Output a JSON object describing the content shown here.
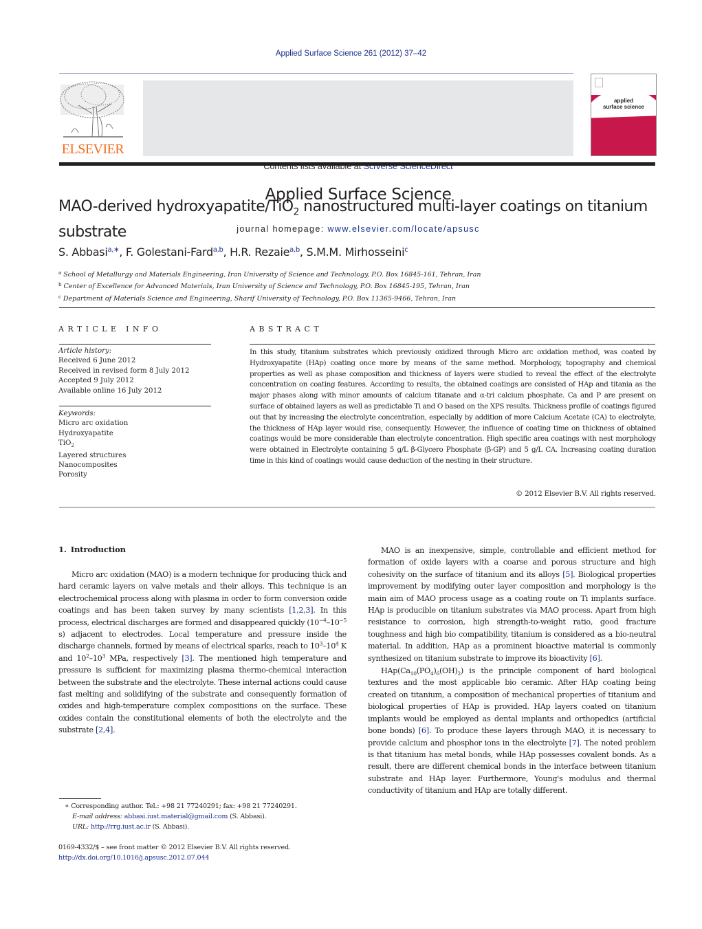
{
  "journal_ref": "Applied Surface Science 261 (2012) 37–42",
  "masthead": {
    "contents_prefix": "Contents lists available at ",
    "contents_link": "SciVerse ScienceDirect",
    "journal_title": "Applied Surface Science",
    "homepage_prefix": "journal homepage: ",
    "homepage_link": "www.elsevier.com/locate/apsusc",
    "publisher_logo_text": "ELSEVIER",
    "cover_title_line1": "applied",
    "cover_title_line2": "surface science"
  },
  "colors": {
    "link": "#1a2d8c",
    "elsevier_orange": "#f26b1d",
    "cover_magenta": "#c8174b",
    "masthead_gray": "#e6e7e8"
  },
  "article": {
    "title_part1": "MAO-derived hydroxyapatite/TiO",
    "title_sub": "2",
    "title_part2": " nanostructured multi-layer coatings on titanium substrate",
    "authors": [
      {
        "name": "S. Abbasi",
        "marks": "a,∗",
        "sep": ", "
      },
      {
        "name": "F. Golestani-Fard",
        "marks": "a,b",
        "sep": ", "
      },
      {
        "name": "H.R. Rezaie",
        "marks": "a,b",
        "sep": ", "
      },
      {
        "name": "S.M.M. Mirhosseini",
        "marks": "c",
        "sep": ""
      }
    ],
    "affiliations": [
      {
        "mark": "a",
        "text": "School of Metallurgy and Materials Engineering, Iran University of Science and Technology, P.O. Box 16845-161, Tehran, Iran"
      },
      {
        "mark": "b",
        "text": "Center of Excellence for Advanced Materials, Iran University of Science and Technology, P.O. Box 16845-195, Tehran, Iran"
      },
      {
        "mark": "c",
        "text": "Department of Materials Science and Engineering, Sharif University of Technology, P.O. Box 11365-9466, Tehran, Iran"
      }
    ]
  },
  "article_info": {
    "heading": "ARTICLE INFO",
    "history_label": "Article history:",
    "history": [
      "Received 6 June 2012",
      "Received in revised form 8 July 2012",
      "Accepted 9 July 2012",
      "Available online 16 July 2012"
    ],
    "keywords_label": "Keywords:",
    "keywords": [
      "Micro arc oxidation",
      "Hydroxyapatite",
      "TiO2",
      "Layered structures",
      "Nanocomposites",
      "Porosity"
    ]
  },
  "abstract": {
    "heading": "ABSTRACT",
    "text": "In this study, titanium substrates which previously oxidized through Micro arc oxidation method, was coated by Hydroxyapatite (HAp) coating once more by means of the same method. Morphology, topography and chemical properties as well as phase composition and thickness of layers were studied to reveal the effect of the electrolyte concentration on coating features. According to results, the obtained coatings are consisted of HAp and titania as the major phases along with minor amounts of calcium titanate and α-tri calcium phosphate. Ca and P are present on surface of obtained layers as well as predictable Ti and O based on the XPS results. Thickness profile of coatings figured out that by increasing the electrolyte concentration, especially by addition of more Calcium Acetate (CA) to electrolyte, the thickness of HAp layer would rise, consequently. However, the influence of coating time on thickness of obtained coatings would be more considerable than electrolyte concentration. High specific area coatings with nest morphology were obtained in Electrolyte containing 5 g/L β-Glycero Phosphate (β-GP) and 5 g/L CA. Increasing coating duration time in this kind of coatings would cause deduction of the nesting in their structure.",
    "copyright": "© 2012 Elsevier B.V. All rights reserved."
  },
  "body": {
    "section_number": "1.",
    "section_title": "Introduction",
    "intro_p1": {
      "t1": "Micro arc oxidation (MAO) is a modern technique for producing thick and hard ceramic layers on valve metals and their alloys. This technique is an electrochemical process along with plasma in order to form conversion oxide coatings and has been taken survey by many scientists ",
      "ref1": "[1,2,3]",
      "t2": ". In this process, electrical discharges are formed and disappeared quickly (10",
      "e1": "−4",
      "t3": "–10",
      "e2": "−5",
      "t4": " s) adjacent to electrodes. Local temperature and pressure inside the discharge channels, formed by means of electrical sparks, reach to 10",
      "e3": "3",
      "t5": "–10",
      "e4": "4",
      "t6": " K and 10",
      "e5": "2",
      "t7": "–10",
      "e6": "3",
      "t8": " MPa, respectively ",
      "ref2": "[3]",
      "t9": ". The mentioned high temperature and pressure is sufficient for maximizing plasma thermo-chemical interaction between the substrate and the electrolyte. These internal actions could cause fast melting and solidifying of the substrate and consequently formation of oxides and high-temperature complex compositions on the surface. These oxides contain the constitutional elements of both the electrolyte and the substrate ",
      "ref3": "[2,4]",
      "t10": "."
    },
    "intro_p2": {
      "t1": "MAO is an inexpensive, simple, controllable and efficient method for formation of oxide layers with a coarse and porous structure and high cohesivity on the surface of titanium and its alloys ",
      "ref1": "[5]",
      "t2": ". Biological properties improvement by modifying outer layer composition and morphology is the main aim of MAO process usage as a coating route on Ti implants surface. HAp is producible on titanium substrates via MAO process. Apart from high resistance to corrosion, high strength-to-weight ratio, good fracture toughness and high bio compatibility, titanium is considered as a bio-neutral material. In addition, HAp as a prominent bioactive material is commonly synthesized on titanium substrate to improve its bioactivity ",
      "ref2": "[6]",
      "t3": "."
    },
    "intro_p3": {
      "t1": "HAp(Ca",
      "s1": "10",
      "t2": "(PO",
      "s2": "4",
      "t3": ")",
      "s3": "6",
      "t4": "(OH)",
      "s4": "2",
      "t5": ") is the principle component of hard biological textures and the most applicable bio ceramic. After HAp coating being created on titanium, a composition of mechanical properties of titanium and biological properties of HAp is provided. HAp layers coated on titanium implants would be employed as dental implants and orthopedics (artificial bone bonds) ",
      "ref1": "[6]",
      "t6": ". To produce these layers through MAO, it is necessary to provide calcium and phosphor ions in the electrolyte ",
      "ref2": "[7]",
      "t7": ". The noted problem is that titanium has metal bonds, while HAp possesses covalent bonds. As a result, there are different chemical bonds in the interface between titanium substrate and HAp layer. Furthermore, Young's modulus and thermal conductivity of titanium and HAp are totally different."
    }
  },
  "footnote": {
    "star": "∗",
    "corresponding": "Corresponding author. Tel.: +98 21 77240291; fax: +98 21 77240291.",
    "email_label": "E-mail address:",
    "email": "abbasi.iust.material@gmail.com",
    "email_suffix": " (S. Abbasi).",
    "url_label": "URL:",
    "url": "http://rrg.iust.ac.ir",
    "url_suffix": " (S. Abbasi)."
  },
  "front_matter": {
    "issn_line": "0169-4332/$ – see front matter © 2012 Elsevier B.V. All rights reserved.",
    "doi": "http://dx.doi.org/10.1016/j.apsusc.2012.07.044"
  }
}
